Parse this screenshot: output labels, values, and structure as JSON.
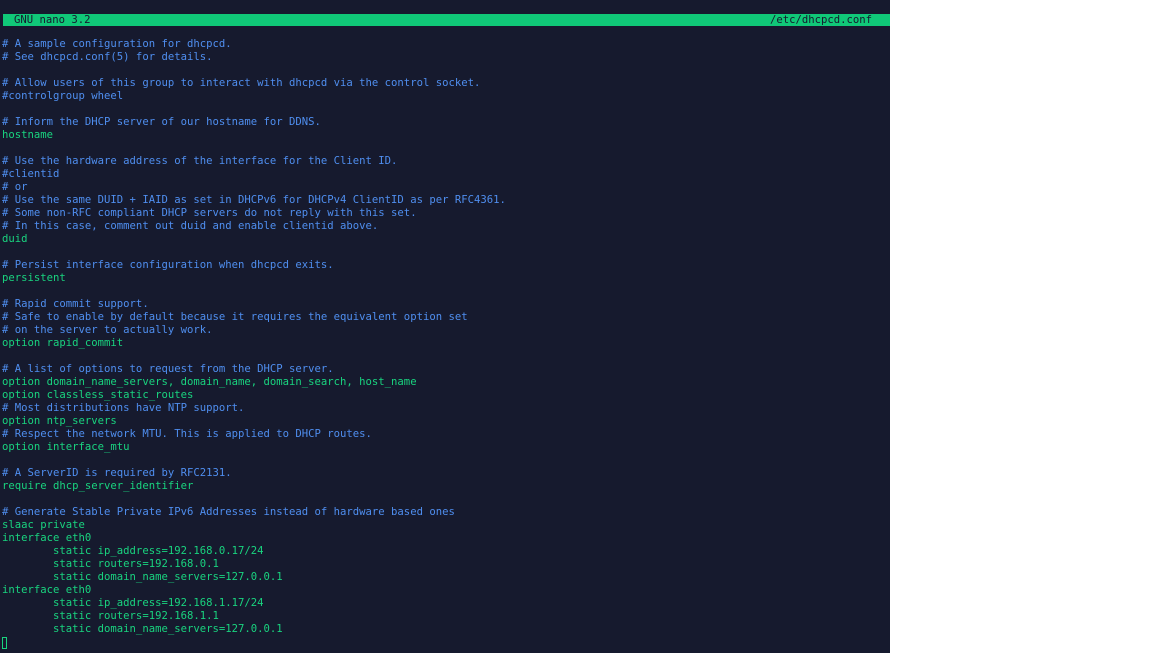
{
  "titlebar": {
    "app_version": "GNU nano 3.2",
    "file_path": "/etc/dhcpcd.conf"
  },
  "colors": {
    "background": "#161a2e",
    "titlebar": "#10c878",
    "comment": "#4f8eef",
    "code": "#19d37f"
  },
  "editor": {
    "lines": [
      {
        "kind": "comment",
        "text": "# A sample configuration for dhcpcd."
      },
      {
        "kind": "comment",
        "text": "# See dhcpcd.conf(5) for details."
      },
      {
        "kind": "blank",
        "text": ""
      },
      {
        "kind": "comment",
        "text": "# Allow users of this group to interact with dhcpcd via the control socket."
      },
      {
        "kind": "comment",
        "text": "#controlgroup wheel"
      },
      {
        "kind": "blank",
        "text": ""
      },
      {
        "kind": "comment",
        "text": "# Inform the DHCP server of our hostname for DDNS."
      },
      {
        "kind": "code",
        "text": "hostname"
      },
      {
        "kind": "blank",
        "text": ""
      },
      {
        "kind": "comment",
        "text": "# Use the hardware address of the interface for the Client ID."
      },
      {
        "kind": "comment",
        "text": "#clientid"
      },
      {
        "kind": "comment",
        "text": "# or"
      },
      {
        "kind": "comment",
        "text": "# Use the same DUID + IAID as set in DHCPv6 for DHCPv4 ClientID as per RFC4361."
      },
      {
        "kind": "comment",
        "text": "# Some non-RFC compliant DHCP servers do not reply with this set."
      },
      {
        "kind": "comment",
        "text": "# In this case, comment out duid and enable clientid above."
      },
      {
        "kind": "code",
        "text": "duid"
      },
      {
        "kind": "blank",
        "text": ""
      },
      {
        "kind": "comment",
        "text": "# Persist interface configuration when dhcpcd exits."
      },
      {
        "kind": "code",
        "text": "persistent"
      },
      {
        "kind": "blank",
        "text": ""
      },
      {
        "kind": "comment",
        "text": "# Rapid commit support."
      },
      {
        "kind": "comment",
        "text": "# Safe to enable by default because it requires the equivalent option set"
      },
      {
        "kind": "comment",
        "text": "# on the server to actually work."
      },
      {
        "kind": "code",
        "text": "option rapid_commit"
      },
      {
        "kind": "blank",
        "text": ""
      },
      {
        "kind": "comment",
        "text": "# A list of options to request from the DHCP server."
      },
      {
        "kind": "code",
        "text": "option domain_name_servers, domain_name, domain_search, host_name"
      },
      {
        "kind": "code",
        "text": "option classless_static_routes"
      },
      {
        "kind": "comment",
        "text": "# Most distributions have NTP support."
      },
      {
        "kind": "code",
        "text": "option ntp_servers"
      },
      {
        "kind": "comment",
        "text": "# Respect the network MTU. This is applied to DHCP routes."
      },
      {
        "kind": "code",
        "text": "option interface_mtu"
      },
      {
        "kind": "blank",
        "text": ""
      },
      {
        "kind": "comment",
        "text": "# A ServerID is required by RFC2131."
      },
      {
        "kind": "code",
        "text": "require dhcp_server_identifier"
      },
      {
        "kind": "blank",
        "text": ""
      },
      {
        "kind": "comment",
        "text": "# Generate Stable Private IPv6 Addresses instead of hardware based ones"
      },
      {
        "kind": "code",
        "text": "slaac private"
      },
      {
        "kind": "code",
        "text": "interface eth0"
      },
      {
        "kind": "code",
        "text": "        static ip_address=192.168.0.17/24"
      },
      {
        "kind": "code",
        "text": "        static routers=192.168.0.1"
      },
      {
        "kind": "code",
        "text": "        static domain_name_servers=127.0.0.1"
      },
      {
        "kind": "code",
        "text": "interface eth0"
      },
      {
        "kind": "code",
        "text": "        static ip_address=192.168.1.17/24"
      },
      {
        "kind": "code",
        "text": "        static routers=192.168.1.1"
      },
      {
        "kind": "code",
        "text": "        static domain_name_servers=127.0.0.1"
      }
    ]
  }
}
